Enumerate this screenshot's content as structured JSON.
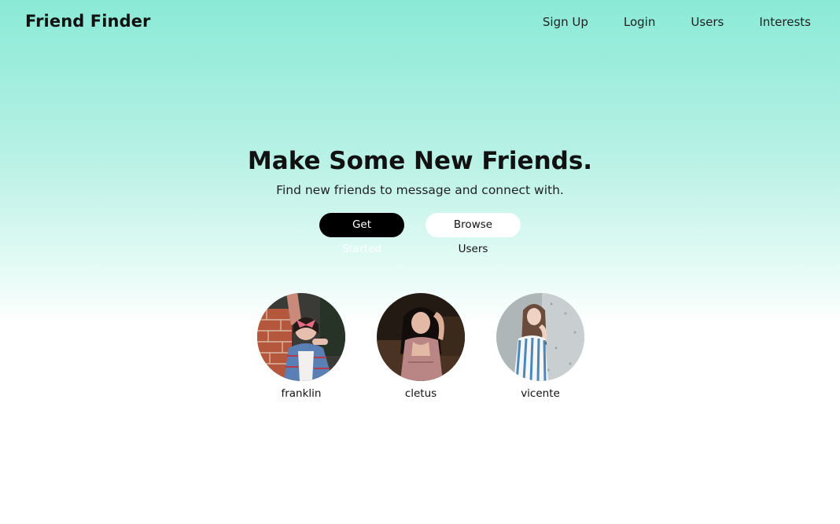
{
  "brand": "Friend Finder",
  "nav": {
    "links": [
      {
        "label": "Sign Up"
      },
      {
        "label": "Login"
      },
      {
        "label": "Users"
      },
      {
        "label": "Interests"
      }
    ]
  },
  "hero": {
    "title": "Make Some New Friends.",
    "subtitle": "Find new friends to message and connect with.",
    "primary_button": "Get Started",
    "secondary_button": "Browse Users"
  },
  "featured_users": [
    {
      "name": "franklin"
    },
    {
      "name": "cletus"
    },
    {
      "name": "vicente"
    }
  ],
  "colors": {
    "gradient_top": "#8aead6",
    "primary_button_bg": "#000000",
    "secondary_button_bg": "#ffffff"
  }
}
